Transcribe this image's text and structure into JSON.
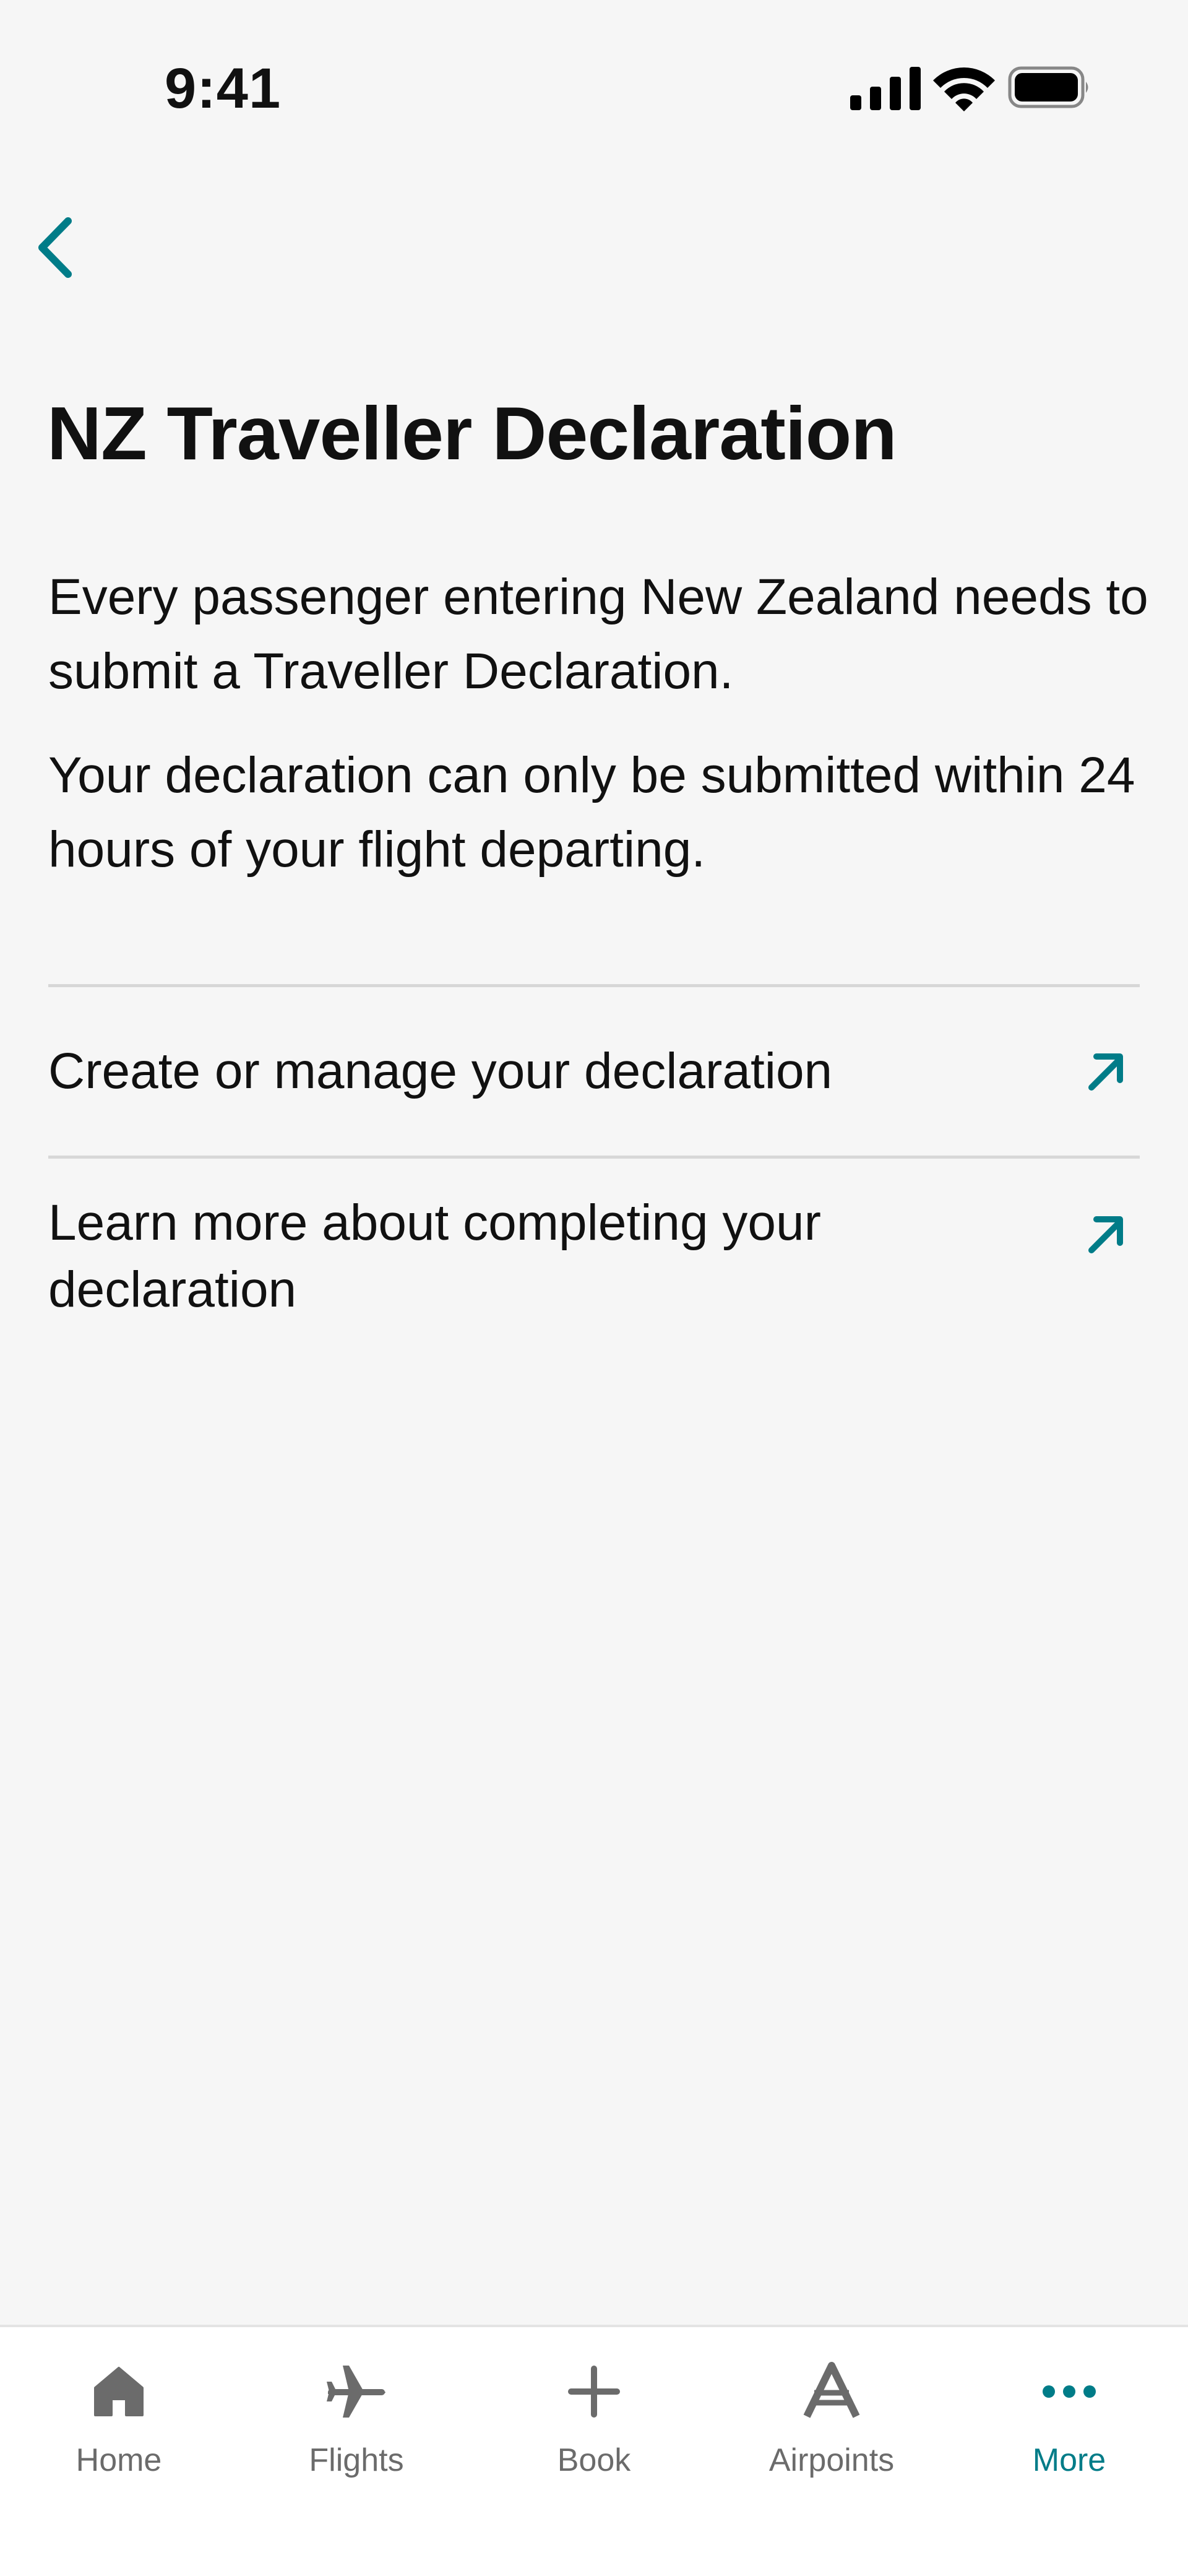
{
  "status_bar": {
    "time": "9:41"
  },
  "nav": {
    "back_icon": "chevron-left-icon"
  },
  "page": {
    "title": "NZ Traveller Declaration",
    "paragraphs": [
      "Every passenger entering New Zealand needs to submit a Traveller Declaration.",
      "Your declaration can only be submitted within 24 hours of your flight departing."
    ]
  },
  "links": [
    {
      "label": "Create or manage your declaration",
      "icon": "external-link-arrow-icon"
    },
    {
      "label": "Learn more about completing your declaration",
      "icon": "external-link-arrow-icon"
    }
  ],
  "tab_bar": {
    "tabs": [
      {
        "label": "Home",
        "icon": "home-icon",
        "active": false
      },
      {
        "label": "Flights",
        "icon": "plane-icon",
        "active": false
      },
      {
        "label": "Book",
        "icon": "plus-icon",
        "active": false
      },
      {
        "label": "Airpoints",
        "icon": "airpoints-icon",
        "active": false
      },
      {
        "label": "More",
        "icon": "more-dots-icon",
        "active": true
      }
    ]
  },
  "colors": {
    "accent": "#007c88",
    "background": "#f6f6f6",
    "text": "#111111",
    "inactive_tab": "#6b6b6b",
    "divider": "#d7d7d7"
  }
}
